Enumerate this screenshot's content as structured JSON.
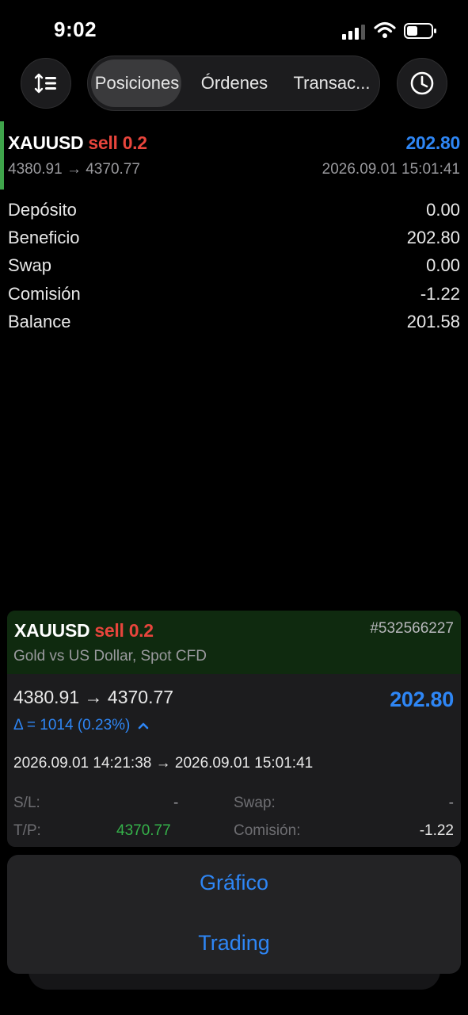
{
  "status": {
    "time": "9:02"
  },
  "tabs": [
    {
      "label": "Posiciones"
    },
    {
      "label": "Órdenes"
    },
    {
      "label": "Transac..."
    }
  ],
  "position": {
    "symbol": "XAUUSD",
    "side": "sell",
    "volume": "0.2",
    "profit": "202.80",
    "prices": "4380.91 → 4370.77",
    "time": "2026.09.01 15:01:41"
  },
  "summary": [
    {
      "label": "Depósito",
      "value": "0.00"
    },
    {
      "label": "Beneficio",
      "value": "202.80"
    },
    {
      "label": "Swap",
      "value": "0.00"
    },
    {
      "label": "Comisión",
      "value": "-1.22"
    },
    {
      "label": "Balance",
      "value": "201.58"
    }
  ],
  "detail": {
    "symbol": "XAUUSD",
    "side": "sell",
    "volume": "0.2",
    "ticket": "#532566227",
    "description": "Gold vs US Dollar, Spot CFD",
    "prices": "4380.91 → 4370.77",
    "profit": "202.80",
    "delta": "Δ = 1014 (0.23%)",
    "times": "2026.09.01 14:21:38 → 2026.09.01 15:01:41",
    "sl_label": "S/L:",
    "sl_value": "-",
    "tp_label": "T/P:",
    "tp_value": "4370.77",
    "swap_label": "Swap:",
    "swap_value": "-",
    "commission_label": "Comisión:",
    "commission_value": "-1.22"
  },
  "actions": {
    "chart": "Gráfico",
    "trading": "Trading"
  },
  "colors": {
    "sell": "#e8453c",
    "profit": "#2e86f5",
    "take_profit": "#35b24a",
    "accent": "#3fa44b"
  }
}
